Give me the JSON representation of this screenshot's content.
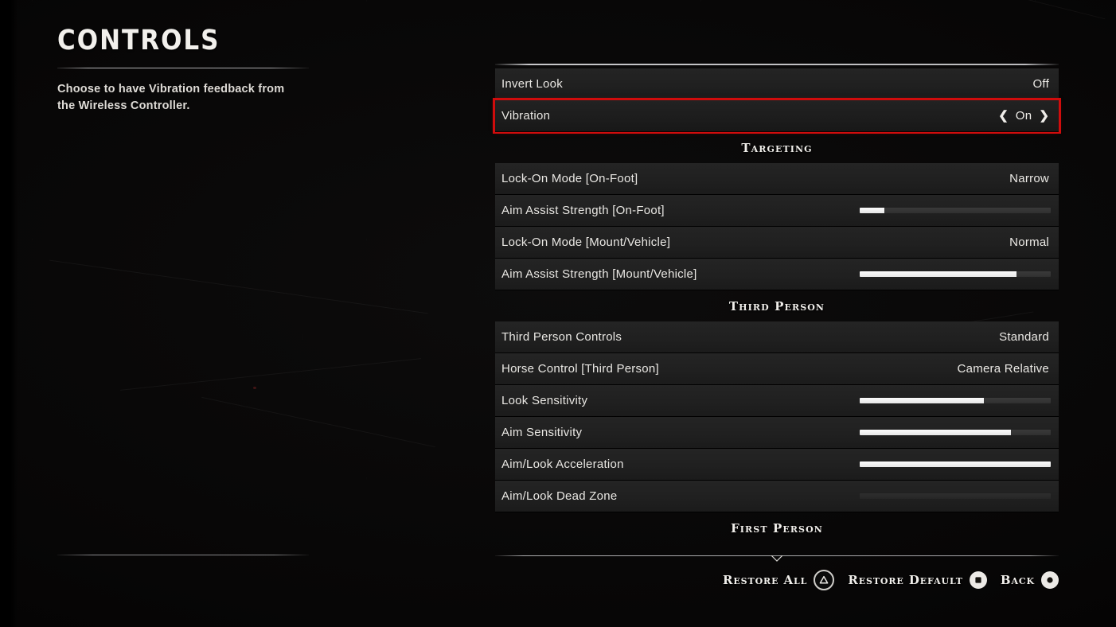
{
  "page": {
    "title": "CONTROLS",
    "description": "Choose to have Vibration feedback from the Wireless Controller."
  },
  "settings": {
    "top_group": [
      {
        "label": "Invert Look",
        "value": "Off",
        "control": "value"
      },
      {
        "label": "Vibration",
        "value": "On",
        "control": "stepper",
        "selected": true,
        "left_arrow": "❮",
        "right_arrow": "❯"
      }
    ],
    "sections": [
      {
        "heading": "Targeting",
        "rows": [
          {
            "label": "Lock-On Mode [On-Foot]",
            "value": "Narrow",
            "control": "value"
          },
          {
            "label": "Aim Assist Strength [On-Foot]",
            "control": "slider",
            "percent": 13
          },
          {
            "label": "Lock-On Mode [Mount/Vehicle]",
            "value": "Normal",
            "control": "value"
          },
          {
            "label": "Aim Assist Strength [Mount/Vehicle]",
            "control": "slider",
            "percent": 82
          }
        ]
      },
      {
        "heading": "Third Person",
        "rows": [
          {
            "label": "Third Person Controls",
            "value": "Standard",
            "control": "value"
          },
          {
            "label": "Horse Control [Third Person]",
            "value": "Camera Relative",
            "control": "value"
          },
          {
            "label": "Look Sensitivity",
            "control": "slider",
            "percent": 65
          },
          {
            "label": "Aim Sensitivity",
            "control": "slider",
            "percent": 79
          },
          {
            "label": "Aim/Look Acceleration",
            "control": "slider",
            "percent": 100
          },
          {
            "label": "Aim/Look Dead Zone",
            "control": "slider",
            "percent": 0
          }
        ]
      },
      {
        "heading": "First Person",
        "rows": []
      }
    ]
  },
  "bottom_bar": {
    "actions": [
      {
        "label": "Restore All",
        "icon": "playstation-triangle-icon",
        "style": "ring"
      },
      {
        "label": "Restore Default",
        "icon": "playstation-square-icon",
        "style": "solid"
      },
      {
        "label": "Back",
        "icon": "playstation-circle-icon",
        "style": "solid"
      }
    ]
  },
  "colors": {
    "highlight_red": "#d00c0c",
    "row_background": "#222222",
    "text": "#e9e7e3",
    "slider_fill": "#f2f2f2"
  }
}
